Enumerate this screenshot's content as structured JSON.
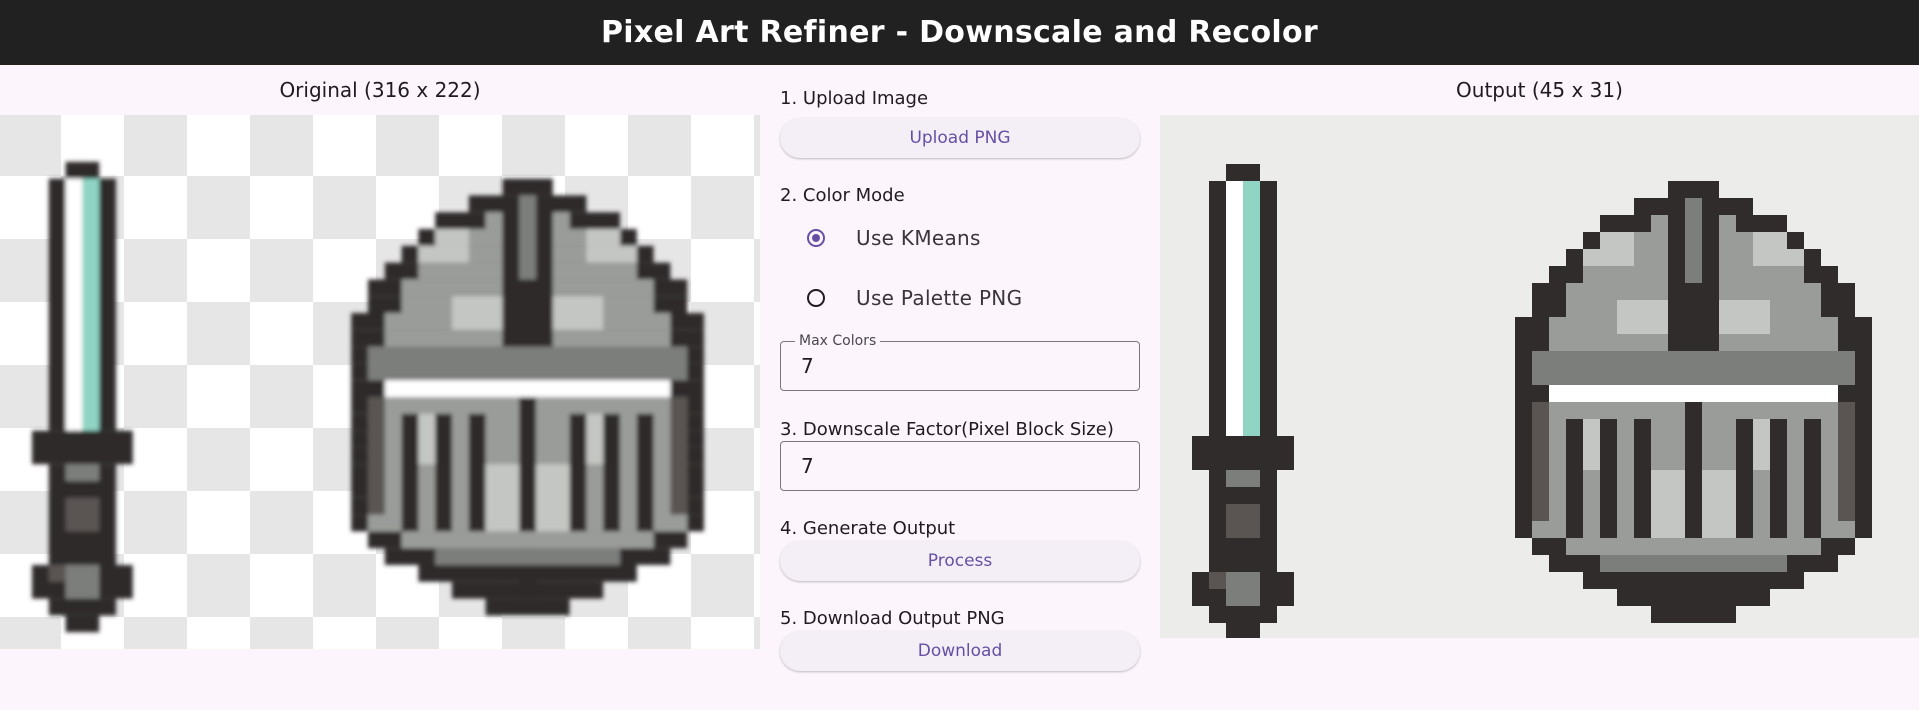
{
  "app": {
    "title": "Pixel Art Refiner - Downscale and Recolor"
  },
  "original": {
    "title": "Original (316 x 222)"
  },
  "output": {
    "title": "Output (45 x 31)"
  },
  "steps": {
    "upload": {
      "label": "1. Upload Image",
      "button": "Upload PNG"
    },
    "color_mode": {
      "label": "2. Color Mode",
      "options": [
        {
          "label": "Use KMeans",
          "selected": true
        },
        {
          "label": "Use Palette PNG",
          "selected": false
        }
      ],
      "max_colors_label": "Max Colors",
      "max_colors_value": "7"
    },
    "downscale": {
      "label": "3. Downscale Factor(Pixel Block Size)",
      "value": "7"
    },
    "generate": {
      "label": "4. Generate Output",
      "button": "Process"
    },
    "download": {
      "label": "5. Download Output PNG",
      "button": "Download"
    }
  },
  "colors": {
    "appbar": "#212121",
    "accent": "#6750a4",
    "background": "#fcf6fc",
    "outline": "#2f2c2b",
    "blade": "#90d4c4",
    "pommel_brown": "#8a5430",
    "metal_light": "#c4c6c3",
    "metal_mid": "#9a9c99",
    "metal_dark": "#7c7e7b"
  }
}
